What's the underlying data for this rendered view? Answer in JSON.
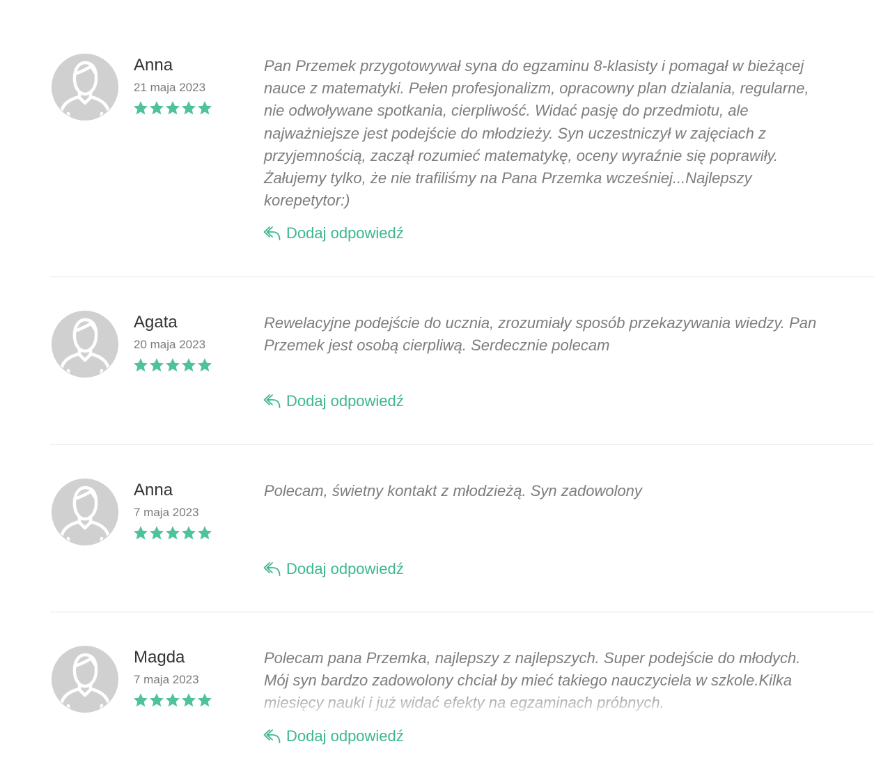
{
  "colors": {
    "accent": "#3cb88c",
    "star": "#4ec39a",
    "text": "#7d7d7d",
    "name": "#333333",
    "avatar_bg": "#d0d0d0",
    "divider": "#e6e6e6"
  },
  "icons": {
    "avatar": "user-avatar-icon",
    "star": "star-icon",
    "reply": "reply-arrow-icon"
  },
  "reviews": [
    {
      "name": "Anna",
      "date": "21 maja 2023",
      "rating": 5,
      "text": "Pan Przemek przygotowywał syna do egzaminu 8-klasisty i pomagał w bieżącej nauce z matematyki. Pełen profesjonalizm, opracowny plan dzialania, regularne, nie odwoływane spotkania, cierpliwość. Widać pasję do przedmiotu, ale najważniejsze jest podejście do młodzieży. Syn uczestniczył w zajęciach z przyjemnością, zaczął rozumieć matematykę, oceny wyraźnie się poprawiły. Żałujemy tylko, że nie trafiliśmy na Pana Przemka wcześniej...Najlepszy korepetytor:)",
      "reply_label": "Dodaj odpowiedź"
    },
    {
      "name": "Agata",
      "date": "20 maja 2023",
      "rating": 5,
      "text": "Rewelacyjne podejście do ucznia, zrozumiały sposób przekazywania wiedzy. Pan Przemek jest osobą cierpliwą. Serdecznie polecam",
      "reply_label": "Dodaj odpowiedź"
    },
    {
      "name": "Anna",
      "date": "7 maja 2023",
      "rating": 5,
      "text": "Polecam, świetny kontakt z młodzieżą. Syn zadowolony",
      "reply_label": "Dodaj odpowiedź"
    },
    {
      "name": "Magda",
      "date": "7 maja 2023",
      "rating": 5,
      "text": "Polecam pana Przemka, najlepszy z najlepszych. Super podejście do młodych. Mój syn bardzo zadowolony chciał by mieć takiego nauczyciela w szkole.Kilka miesięcy nauki i już widać efekty na egzaminach próbnych.",
      "reply_label": "Dodaj odpowiedź"
    }
  ]
}
